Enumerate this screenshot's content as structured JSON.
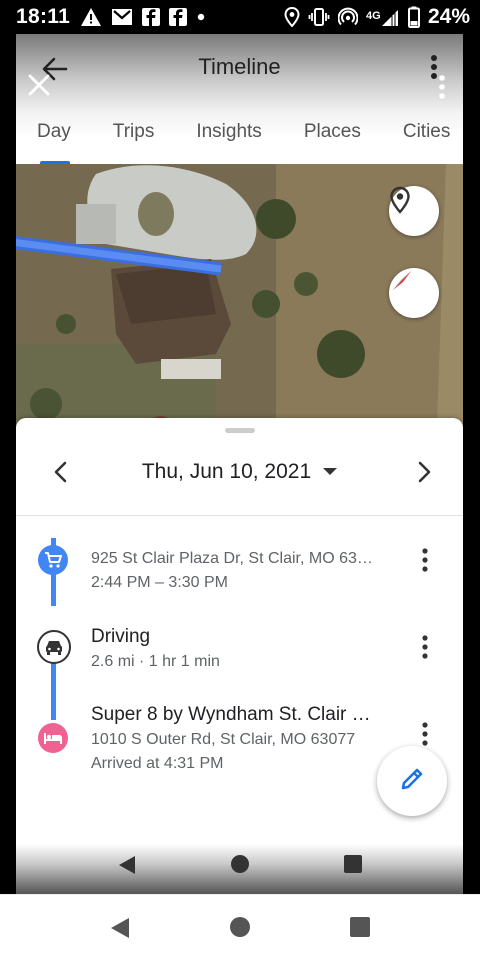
{
  "status_bar": {
    "time": "18:11",
    "battery": "24%",
    "network": "4G"
  },
  "header": {
    "title": "Timeline"
  },
  "tabs": [
    {
      "label": "Day",
      "active": true
    },
    {
      "label": "Trips",
      "active": false
    },
    {
      "label": "Insights",
      "active": false
    },
    {
      "label": "Places",
      "active": false
    },
    {
      "label": "Cities",
      "active": false
    }
  ],
  "map": {
    "location_button_icon": "location-pin-icon",
    "compass_button_icon": "compass-icon"
  },
  "sheet": {
    "date": "Thu, Jun 10, 2021",
    "items": [
      {
        "icon": "shopping-cart-icon",
        "icon_color": "#4285f4",
        "title": "",
        "line1": "925 St Clair Plaza Dr, St Clair, MO 63…",
        "line2": "2:44 PM – 3:30 PM"
      },
      {
        "icon": "car-icon",
        "icon_color": "#ffffff",
        "title": "Driving",
        "line1": "2.6 mi · 1 hr 1 min",
        "line2": ""
      },
      {
        "icon": "hotel-bed-icon",
        "icon_color": "#f06292",
        "title": "Super 8 by Wyndham St. Clair …",
        "line1": "1010 S Outer Rd, St Clair, MO 63077",
        "line2": "Arrived at 4:31 PM"
      }
    ]
  },
  "colors": {
    "accent": "#1a73e8",
    "timeline_line": "#4285f4",
    "hotel_pink": "#f06292"
  }
}
